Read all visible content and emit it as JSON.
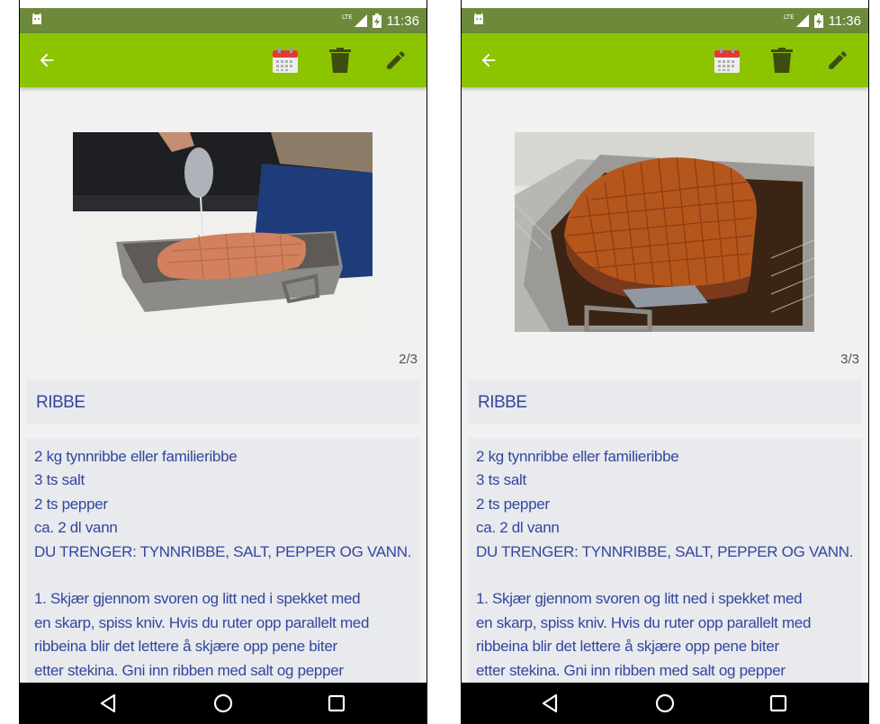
{
  "screens": [
    {
      "status": {
        "time": "11:36",
        "network": "LTE"
      },
      "page_counter": "2/3",
      "photo": "pouring-water-over-rib-roast",
      "title": "RIBBE",
      "body": {
        "line1": "2 kg tynnribbe eller familieribbe",
        "line2": " 3 ts salt",
        "line3": " 2 ts pepper",
        "line4": " ca. 2 dl vann",
        "line5": " DU TRENGER: TYNNRIBBE, SALT, PEPPER OG VANN.",
        "line6": " 1. Skjær gjennom svoren og litt ned i spekket med",
        "line7": "en skarp, spiss kniv. Hvis du ruter opp parallelt med",
        "line8": "ribbeina blir det lettere å skjære opp pene biter",
        "line9": "etter stekina. Gni inn ribben med salt og pepper"
      }
    },
    {
      "status": {
        "time": "11:36",
        "network": "LTE"
      },
      "page_counter": "3/3",
      "photo": "roasted-crispy-pork-rib",
      "title": "RIBBE",
      "body": {
        "line1": "2 kg tynnribbe eller familieribbe",
        "line2": " 3 ts salt",
        "line3": " 2 ts pepper",
        "line4": " ca. 2 dl vann",
        "line5": " DU TRENGER: TYNNRIBBE, SALT, PEPPER OG VANN.",
        "line6": " 1. Skjær gjennom svoren og litt ned i spekket med",
        "line7": "en skarp, spiss kniv. Hvis du ruter opp parallelt med",
        "line8": "ribbeina blir det lettere å skjære opp pene biter",
        "line9": "etter stekina. Gni inn ribben med salt og pepper"
      }
    }
  ],
  "toolbar": {
    "back_icon": "arrow-back-icon",
    "calendar_icon": "calendar-icon",
    "delete_icon": "trash-icon",
    "edit_icon": "pencil-icon"
  },
  "navigation": {
    "back_icon": "triangle-back-icon",
    "home_icon": "circle-home-icon",
    "recents_icon": "square-recents-icon"
  },
  "colors": {
    "app_bar": "#8dc400",
    "status_bar": "#6d8a3a",
    "text": "#3445a0",
    "card": "#e8eaed",
    "background": "#f1f1f1"
  }
}
